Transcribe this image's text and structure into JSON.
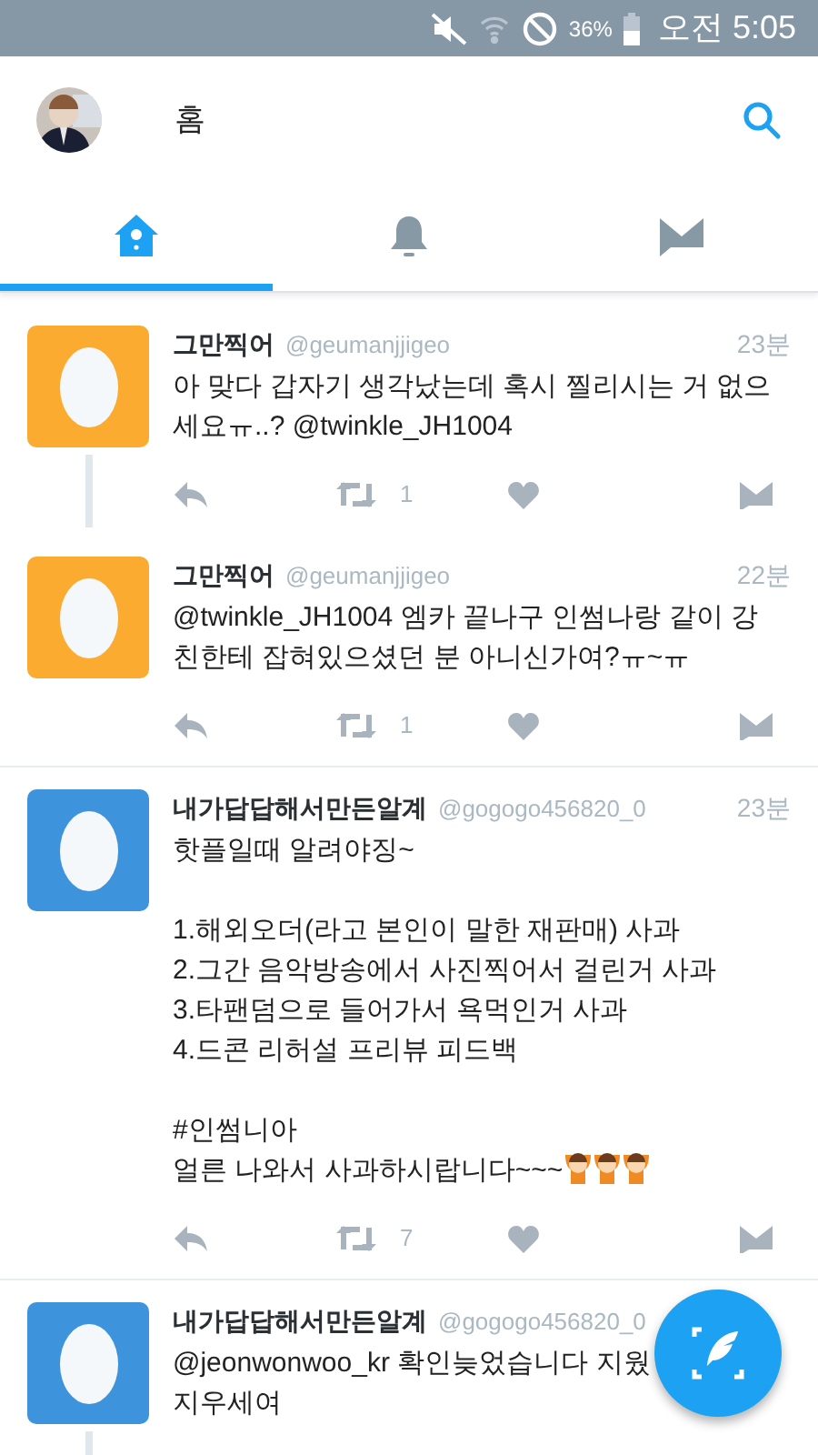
{
  "status_bar": {
    "battery": "36%",
    "time": "오전 5:05"
  },
  "header": {
    "title": "홈"
  },
  "tabs": [
    {
      "kind": "home",
      "selected": true
    },
    {
      "kind": "bell",
      "selected": false
    },
    {
      "kind": "mail",
      "selected": false
    }
  ],
  "tweets": [
    {
      "name": "그만찍어",
      "handle": "@geumanjjigeo",
      "time": "23분",
      "color": "#fbab2f",
      "body": "아 맞다 갑자기 생각났는데 혹시 찔리시는 거 없으세요ㅠ..? @twinkle_JH1004",
      "retweets": "1",
      "thread_continues": true
    },
    {
      "name": "그만찍어",
      "handle": "@geumanjjigeo",
      "time": "22분",
      "color": "#fbab2f",
      "body": "@twinkle_JH1004 엠카 끝나구 인썸나랑 같이 강친한테 잡혀있으셨던 분 아니신가여?ㅠ~ㅠ",
      "retweets": "1",
      "thread_continues": false
    },
    {
      "name": "내가답답해서만든알계",
      "handle": "@gogogo456820_0",
      "time": "23분",
      "color": "#3d93dc",
      "body": "핫플일때 알려야징~\n\n1.해외오더(라고 본인이 말한 재판매) 사과\n2.그간 음악방송에서 사진찍어서 걸린거 사과\n3.타팬덤으로 들어가서 욕먹인거 사과\n4.드콘 리허설 프리뷰 피드백\n\n#인썸니아\n얼른 나와서 사과하시랍니다~~~",
      "retweets": "7",
      "thread_continues": false,
      "emojis": [
        {
          "kind": "face"
        },
        {
          "kind": "face"
        },
        {
          "kind": "face"
        }
      ]
    },
    {
      "name": "내가답답해서만든알계",
      "handle": "@gogogo456820_0",
      "color": "#3d93dc",
      "body": "@jeonwonwoo_kr 확인늦었습니다 지웠\n지우세여",
      "thread_continues": true
    }
  ]
}
